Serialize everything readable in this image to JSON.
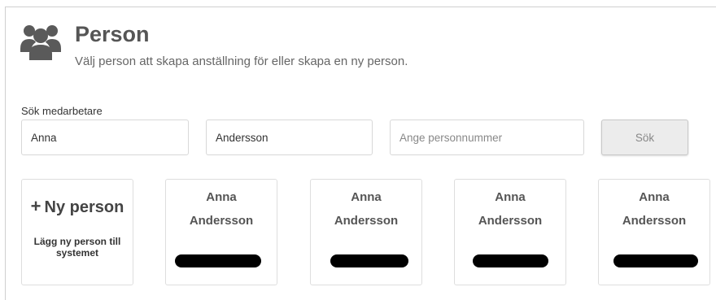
{
  "header": {
    "title": "Person",
    "subtitle": "Välj person att skapa anställning för eller skapa en ny person.",
    "icon": "users-icon"
  },
  "search": {
    "label": "Sök medarbetare",
    "first_name_value": "Anna",
    "last_name_value": "Andersson",
    "personnummer_placeholder": "Ange personnummer",
    "button_label": "Sök"
  },
  "new_person": {
    "title": "Ny person",
    "description": "Lägg ny person till systemet"
  },
  "results": [
    {
      "first_name": "Anna",
      "last_name": "Andersson"
    },
    {
      "first_name": "Anna",
      "last_name": "Andersson"
    },
    {
      "first_name": "Anna",
      "last_name": "Andersson"
    },
    {
      "first_name": "Anna",
      "last_name": "Andersson"
    }
  ]
}
